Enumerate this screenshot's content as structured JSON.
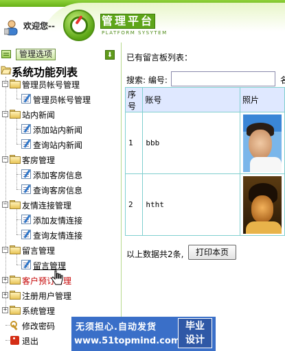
{
  "header": {
    "welcome": "欢迎您--",
    "brand": "管理平台",
    "brand_sub": "PLATFORM SYSYTEM"
  },
  "sidebar": {
    "options_label": "管理选项",
    "collapse_glyph": "⬇",
    "title": "系统功能列表",
    "groups": [
      {
        "label": "管理员帐号管理",
        "children": [
          "管理员帐号管理"
        ]
      },
      {
        "label": "站内新闻",
        "children": [
          "添加站内新闻",
          "查询站内新闻"
        ]
      },
      {
        "label": "客房管理",
        "children": [
          "添加客房信息",
          "查询客房信息"
        ]
      },
      {
        "label": "友情连接管理",
        "children": [
          "添加友情连接",
          "查询友情连接"
        ]
      },
      {
        "label": "留言管理",
        "children": [
          "留言管理"
        ]
      },
      {
        "label": "客户预订管理",
        "children": []
      },
      {
        "label": "注册用户管理",
        "children": []
      },
      {
        "label": "系统管理",
        "children": []
      }
    ],
    "change_password": "修改密码",
    "logout": "退出"
  },
  "main": {
    "heading": "已有留言板列表：",
    "search_label": "搜索: 编号:",
    "search_value": "",
    "search_label2": "名",
    "table": {
      "headers": [
        "序号",
        "账号",
        "照片"
      ],
      "rows": [
        {
          "index": "1",
          "account": "bbb",
          "photo": "photo-male-1"
        },
        {
          "index": "2",
          "account": "htht",
          "photo": "photo-male-2"
        }
      ]
    },
    "total_text": "以上数据共2条,",
    "print_button": "打印本页"
  },
  "watermark": {
    "slogan": "无须担心.自动发货",
    "url": "www.51topmind.com",
    "tag_line1": "毕业",
    "tag_line2": "设计"
  },
  "colors": {
    "accent_green": "#67b117",
    "table_header_bg": "#dfe8ff",
    "table_border": "#7fcfcf",
    "banner_blue": "#3a6fc8",
    "hover_red": "#c40000"
  }
}
